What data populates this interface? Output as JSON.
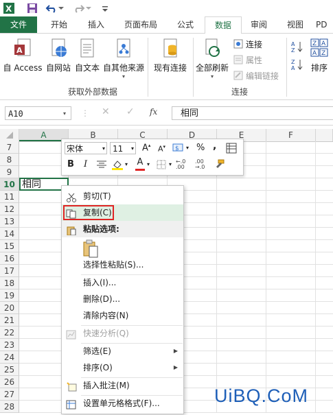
{
  "qat": {
    "icons": [
      "excel-logo-icon",
      "save-icon",
      "undo-icon",
      "redo-icon",
      "customize-icon"
    ]
  },
  "tabs": [
    "文件",
    "开始",
    "插入",
    "页面布局",
    "公式",
    "数据",
    "审阅",
    "视图",
    "PD"
  ],
  "ribbon": {
    "external": {
      "access": "自 Access",
      "web": "自网站",
      "text": "自文本",
      "other": "自其他来源",
      "group": "获取外部数据"
    },
    "existing": "现有连接",
    "refresh_all": "全部刷新",
    "connections": {
      "link": "连接",
      "props": "属性",
      "edit": "编辑链接",
      "group": "连接"
    },
    "sort": "排序"
  },
  "formula_bar": {
    "name_box": "A10",
    "fx": "fx",
    "content": "相同"
  },
  "columns": [
    "A",
    "B",
    "C",
    "D",
    "E",
    "F"
  ],
  "rows": [
    "7",
    "8",
    "9",
    "10",
    "11",
    "12",
    "13",
    "14",
    "15",
    "16",
    "17",
    "18",
    "19",
    "20",
    "21",
    "22",
    "23",
    "24",
    "25",
    "26",
    "27",
    "28"
  ],
  "cell_a10": "相同",
  "mini_toolbar": {
    "font": "宋体",
    "size": "11",
    "percent": "%",
    "comma": ",",
    "bold": "B",
    "italic": "I",
    "font_color_letter": "A"
  },
  "context_menu": {
    "cut": "剪切(T)",
    "copy": "复制(C)",
    "paste_options": "粘贴选项:",
    "paste_special": "选择性粘贴(S)...",
    "insert": "插入(I)...",
    "delete": "删除(D)...",
    "clear": "清除内容(N)",
    "quick_analysis": "快速分析(Q)",
    "filter": "筛选(E)",
    "sort": "排序(O)",
    "insert_comment": "插入批注(M)",
    "format_cells": "设置单元格格式(F)..."
  },
  "watermark": "UiBQ.CoM",
  "colors": {
    "excel_green": "#217346",
    "highlight_red": "#e02424",
    "hover_green": "#dff0e3",
    "watermark_blue": "#1e5fb8"
  }
}
